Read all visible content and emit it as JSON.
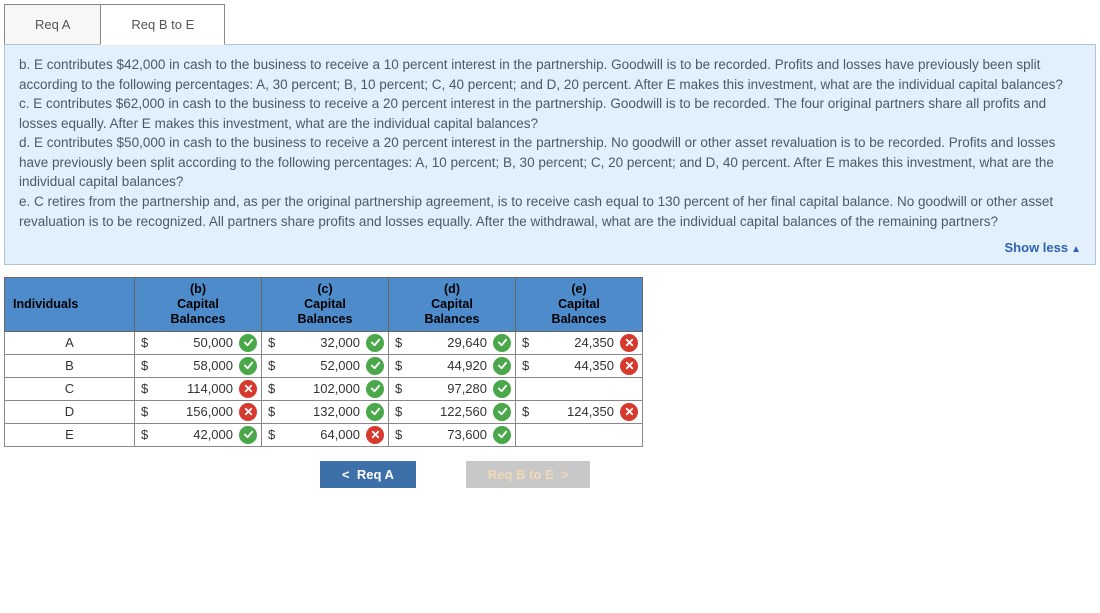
{
  "tabs": {
    "a": "Req A",
    "be": "Req B to E"
  },
  "question": {
    "b": "b. E contributes $42,000 in cash to the business to receive a 10 percent interest in the partnership. Goodwill is to be recorded. Profits and losses have previously been split according to the following percentages: A, 30 percent; B, 10 percent; C, 40 percent; and D, 20 percent. After E makes this investment, what are the individual capital balances?",
    "c": "c. E contributes $62,000 in cash to the business to receive a 20 percent interest in the partnership. Goodwill is to be recorded. The four original partners share all profits and losses equally. After E makes this investment, what are the individual capital balances?",
    "d": "d. E contributes $50,000 in cash to the business to receive a 20 percent interest in the partnership. No goodwill or other asset revaluation is to be recorded. Profits and losses have previously been split according to the following percentages: A, 10 percent; B, 30 percent; C, 20 percent; and D, 40 percent. After E makes this investment, what are the individual capital balances?",
    "e": "e. C retires from the partnership and, as per the original partnership agreement, is to receive cash equal to 130 percent of her final capital balance. No goodwill or other asset revaluation is to be recognized. All partners share profits and losses equally. After the withdrawal, what are the individual capital balances of the remaining partners?"
  },
  "showless": "Show less",
  "headers": {
    "ind": "Individuals",
    "b": "(b)\nCapital\nBalances",
    "c": "(c)\nCapital\nBalances",
    "d": "(d)\nCapital\nBalances",
    "e": "(e)\nCapital\nBalances"
  },
  "rows": [
    {
      "label": "A",
      "b": {
        "d": "$",
        "v": "50,000",
        "m": "correct"
      },
      "c": {
        "d": "$",
        "v": "32,000",
        "m": "correct"
      },
      "d": {
        "d": "$",
        "v": "29,640",
        "m": "correct"
      },
      "e": {
        "d": "$",
        "v": "24,350",
        "m": "wrong"
      }
    },
    {
      "label": "B",
      "b": {
        "d": "$",
        "v": "58,000",
        "m": "correct"
      },
      "c": {
        "d": "$",
        "v": "52,000",
        "m": "correct"
      },
      "d": {
        "d": "$",
        "v": "44,920",
        "m": "correct"
      },
      "e": {
        "d": "$",
        "v": "44,350",
        "m": "wrong"
      }
    },
    {
      "label": "C",
      "b": {
        "d": "$",
        "v": "114,000",
        "m": "wrong"
      },
      "c": {
        "d": "$",
        "v": "102,000",
        "m": "correct"
      },
      "d": {
        "d": "$",
        "v": "97,280",
        "m": "correct"
      },
      "e": null
    },
    {
      "label": "D",
      "b": {
        "d": "$",
        "v": "156,000",
        "m": "wrong"
      },
      "c": {
        "d": "$",
        "v": "132,000",
        "m": "correct"
      },
      "d": {
        "d": "$",
        "v": "122,560",
        "m": "correct"
      },
      "e": {
        "d": "$",
        "v": "124,350",
        "m": "wrong"
      }
    },
    {
      "label": "E",
      "b": {
        "d": "$",
        "v": "42,000",
        "m": "correct"
      },
      "c": {
        "d": "$",
        "v": "64,000",
        "m": "wrong"
      },
      "d": {
        "d": "$",
        "v": "73,600",
        "m": "correct"
      },
      "e": null
    }
  ],
  "nav": {
    "prev": "Req A",
    "next": "Req B to E"
  }
}
